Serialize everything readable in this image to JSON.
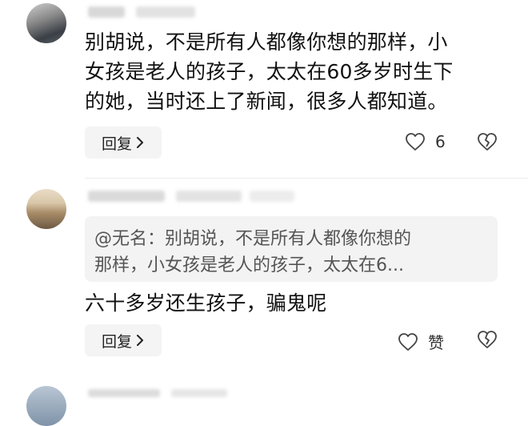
{
  "comments": [
    {
      "text_lines": [
        "别胡说，不是所有人都像你想的那样，小",
        "女孩是老人的孩子，太太在60多岁时生下",
        "的她，当时还上了新闻，很多人都知道。"
      ],
      "reply_label": "回复",
      "like_count": "6"
    },
    {
      "quote_lines": [
        "@无名：别胡说，不是所有人都像你想的",
        "那样，小女孩是老人的孩子，太太在6..."
      ],
      "text": "六十多岁还生孩子，骗鬼呢",
      "reply_label": "回复",
      "like_label": "赞"
    }
  ]
}
